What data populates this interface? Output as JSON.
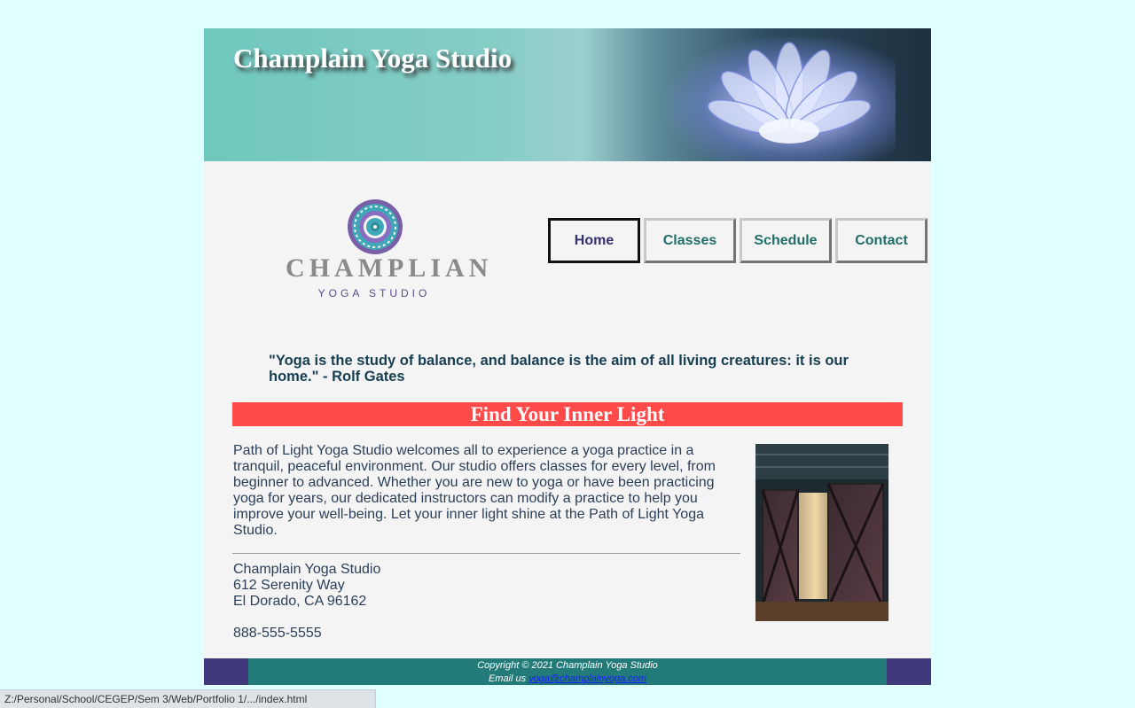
{
  "banner": {
    "title": "Champlain Yoga Studio",
    "image": "lotus-flower-icon"
  },
  "logo": {
    "word": "CHAMPLIAN",
    "sub": "YOGA STUDIO",
    "icon": "mandala-icon"
  },
  "nav": {
    "home": "Home",
    "classes": "Classes",
    "schedule": "Schedule",
    "contact": "Contact"
  },
  "quote": "\"Yoga is the study of balance, and balance is the aim of all living creatures: it is our home.\" - Rolf Gates",
  "heading": "Find Your Inner Light",
  "intro": "Path of Light Yoga Studio welcomes all to experience a yoga practice in a tranquil, peaceful environment. Our studio offers classes for every level, from beginner to advanced. Whether you are new to yoga or have been practicing yoga for years, our dedicated instructors can modify a practice to help you improve your well-being. Let your inner light shine at the Path of Light Yoga Studio.",
  "address": {
    "name": "Champlain Yoga Studio",
    "street": "612 Serenity Way",
    "city": "El Dorado, CA 96162",
    "phone": "888-555-5555"
  },
  "photo": "barn-door-photo",
  "footer": {
    "copyright": "Copyright © 2021 Champlain Yoga Studio",
    "email_prefix": "Email us",
    "email": "yoga@champlainyoga.com"
  },
  "statusbar": {
    "url": "Z:/Personal/School/CEGEP/Sem 3/Web/Portfolio 1/.../index.html"
  },
  "colors": {
    "page_bg": "#e0ffff",
    "content_bg": "#f4f4f4",
    "heading_bar": "#ff4a4a",
    "footer": "#227b78",
    "footer_caps": "#403a7c",
    "nav_text": "#1f6f68"
  }
}
